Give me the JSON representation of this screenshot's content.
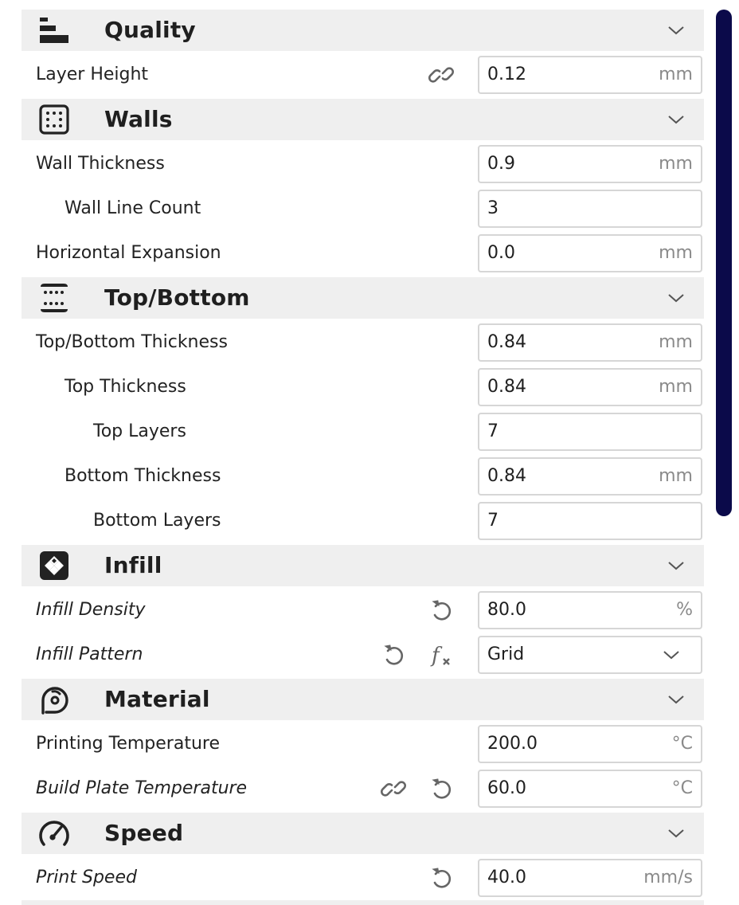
{
  "sections": [
    {
      "title": "Quality",
      "icon": "quality-icon",
      "settings": [
        {
          "label": "Layer Height",
          "value": "0.12",
          "unit": "mm",
          "indent": 0,
          "italic": false,
          "icons": [
            "link-icon"
          ]
        }
      ]
    },
    {
      "title": "Walls",
      "icon": "walls-icon",
      "settings": [
        {
          "label": "Wall Thickness",
          "value": "0.9",
          "unit": "mm",
          "indent": 0,
          "italic": false,
          "icons": []
        },
        {
          "label": "Wall Line Count",
          "value": "3",
          "unit": "",
          "indent": 1,
          "italic": false,
          "icons": []
        },
        {
          "label": "Horizontal Expansion",
          "value": "0.0",
          "unit": "mm",
          "indent": 0,
          "italic": false,
          "icons": []
        }
      ]
    },
    {
      "title": "Top/Bottom",
      "icon": "top-bottom-icon",
      "settings": [
        {
          "label": "Top/Bottom Thickness",
          "value": "0.84",
          "unit": "mm",
          "indent": 0,
          "italic": false,
          "icons": []
        },
        {
          "label": "Top Thickness",
          "value": "0.84",
          "unit": "mm",
          "indent": 1,
          "italic": false,
          "icons": []
        },
        {
          "label": "Top Layers",
          "value": "7",
          "unit": "",
          "indent": 2,
          "italic": false,
          "icons": []
        },
        {
          "label": "Bottom Thickness",
          "value": "0.84",
          "unit": "mm",
          "indent": 1,
          "italic": false,
          "icons": []
        },
        {
          "label": "Bottom Layers",
          "value": "7",
          "unit": "",
          "indent": 2,
          "italic": false,
          "icons": []
        }
      ]
    },
    {
      "title": "Infill",
      "icon": "infill-icon",
      "settings": [
        {
          "label": "Infill Density",
          "value": "80.0",
          "unit": "%",
          "indent": 0,
          "italic": true,
          "icons": [
            "reset-icon"
          ]
        },
        {
          "label": "Infill Pattern",
          "value": "Grid",
          "unit": "",
          "indent": 0,
          "italic": true,
          "icons": [
            "reset-icon",
            "function-icon"
          ],
          "dropdown": true
        }
      ]
    },
    {
      "title": "Material",
      "icon": "material-icon",
      "settings": [
        {
          "label": "Printing Temperature",
          "value": "200.0",
          "unit": "°C",
          "indent": 0,
          "italic": false,
          "icons": []
        },
        {
          "label": "Build Plate Temperature",
          "value": "60.0",
          "unit": "°C",
          "indent": 0,
          "italic": true,
          "icons": [
            "link-icon",
            "reset-icon"
          ]
        }
      ]
    },
    {
      "title": "Speed",
      "icon": "speed-icon",
      "settings": [
        {
          "label": "Print Speed",
          "value": "40.0",
          "unit": "mm/s",
          "indent": 0,
          "italic": true,
          "icons": [
            "reset-icon"
          ]
        }
      ]
    }
  ],
  "colors": {
    "header_bg": "#efefef",
    "scrollbar": "#0b0a4a",
    "text": "#1f1f1f",
    "unit_text": "#8a8a8a",
    "icon_gray": "#666666"
  }
}
